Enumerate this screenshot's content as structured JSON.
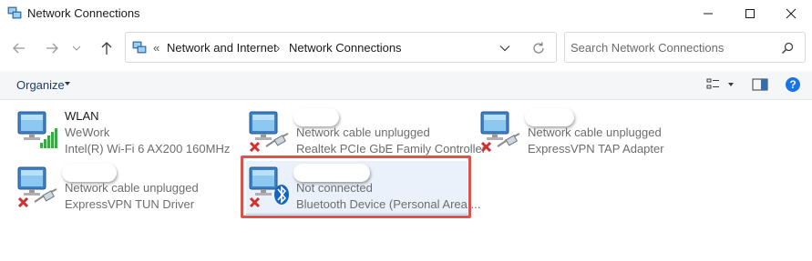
{
  "window": {
    "title": "Network Connections",
    "controls": {
      "minimize": "minimize",
      "maximize": "maximize",
      "close": "close"
    }
  },
  "address_bar": {
    "overflow": "«",
    "breadcrumbs": [
      "Network and Internet",
      "Network Connections"
    ],
    "separator": "›"
  },
  "search": {
    "placeholder": "Search Network Connections"
  },
  "command_bar": {
    "organize_label": "Organize"
  },
  "connections": [
    {
      "name": "WLAN",
      "status": "WeWork",
      "device": "Intel(R) Wi-Fi 6 AX200 160MHz",
      "type": "wifi",
      "disconnected": false,
      "redacted": false
    },
    {
      "name": "",
      "status": "Network cable unplugged",
      "device": "Realtek PCIe GbE Family Controller",
      "type": "ethernet",
      "disconnected": true,
      "redacted": true
    },
    {
      "name": "",
      "status": "Network cable unplugged",
      "device": "ExpressVPN TAP Adapter",
      "type": "ethernet",
      "disconnected": true,
      "redacted": true
    },
    {
      "name": "",
      "status": "Network cable unplugged",
      "device": "ExpressVPN TUN Driver",
      "type": "ethernet",
      "disconnected": true,
      "redacted": true
    },
    {
      "name": "",
      "status": "Not connected",
      "device": "Bluetooth Device (Personal Area ...",
      "type": "bluetooth",
      "disconnected": true,
      "redacted": true,
      "selected": true
    }
  ],
  "colors": {
    "highlight_border": "#d9534f",
    "selection_bg": "#eaf1fb",
    "link_blue": "#1e3a5f",
    "help_blue": "#1a73e8",
    "bluetooth_blue": "#1565c0",
    "error_red": "#d32f2f"
  }
}
